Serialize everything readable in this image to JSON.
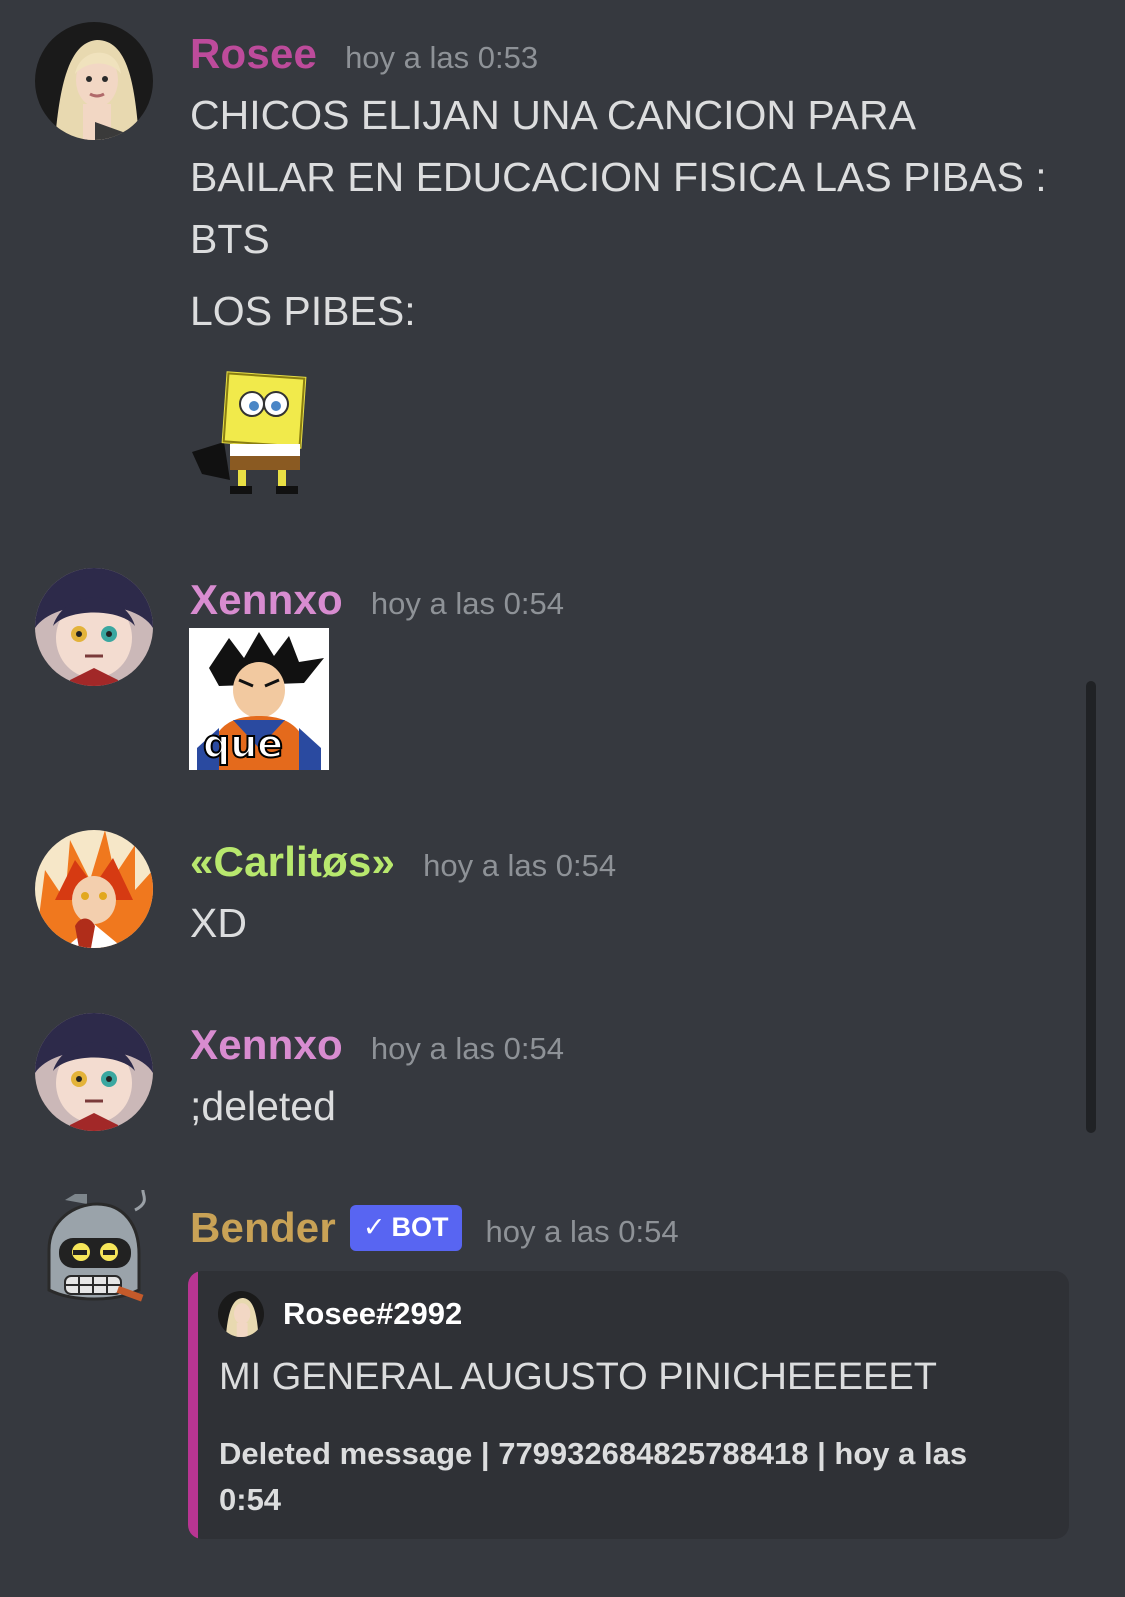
{
  "messages": [
    {
      "username": "Rosee",
      "username_color": "#bd4b9b",
      "timestamp": "hoy a las 0:53",
      "avatar_icon": "avatar-blonde-woman",
      "content_lines": [
        "CHICOS ELIJAN UNA CANCION PARA",
        "BAILAR EN EDUCACION FISICA LAS PIBAS :",
        "BTS"
      ],
      "content_line2": "LOS PIBES:",
      "emoji_icon": "spongebob-dancing-emoji"
    },
    {
      "username": "Xennxo",
      "username_color": "#d88cd0",
      "timestamp": "hoy a las 0:54",
      "avatar_icon": "avatar-anime-girl",
      "sticker_text": "que",
      "sticker_icon": "goku-que-sticker"
    },
    {
      "username": "«Carlitøs»",
      "username_color": "#b8e86e",
      "timestamp": "hoy a las 0:54",
      "avatar_icon": "avatar-anime-flame-hair",
      "content": "XD"
    },
    {
      "username": "Xennxo",
      "username_color": "#d88cd0",
      "timestamp": "hoy a las 0:54",
      "avatar_icon": "avatar-anime-girl",
      "content": ";deleted"
    },
    {
      "username": "Bender",
      "username_color": "#c9a256",
      "timestamp": "hoy a las 0:54",
      "avatar_icon": "avatar-bender-robot",
      "bot_tag": "BOT",
      "bot_tag_color": "#5865f2",
      "embed": {
        "accent_color": "#b83592",
        "author": "Rosee#2992",
        "description": "MI GENERAL AUGUSTO PINICHEEEEET",
        "footer_line1": "Deleted message | 779932684825788418 | hoy a las",
        "footer_line2": "0:54"
      }
    }
  ]
}
